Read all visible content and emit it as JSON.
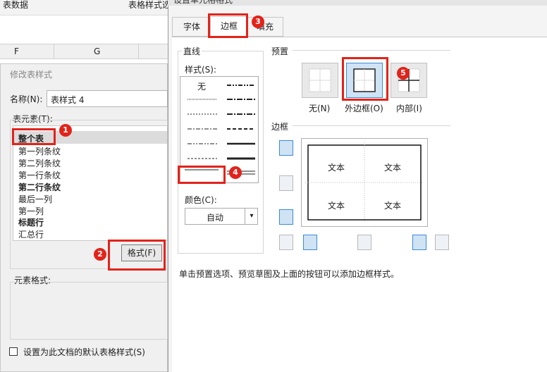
{
  "excel": {
    "toolbar": {
      "item_left": "表数据",
      "item_right": "表格样式选"
    },
    "columns": [
      "F",
      "G"
    ]
  },
  "modify_dialog": {
    "title": "修改表样式",
    "name_label": "名称(N):",
    "name_value": "表样式 4",
    "elements_label": "表元素(T):",
    "elements": [
      {
        "label": "整个表",
        "bold": true,
        "selected": true
      },
      {
        "label": "第一列条纹",
        "bold": false
      },
      {
        "label": "第二列条纹",
        "bold": false
      },
      {
        "label": "第一行条纹",
        "bold": false
      },
      {
        "label": "第二行条纹",
        "bold": true
      },
      {
        "label": "最后一列",
        "bold": false
      },
      {
        "label": "第一列",
        "bold": false
      },
      {
        "label": "标题行",
        "bold": true
      },
      {
        "label": "汇总行",
        "bold": false
      }
    ],
    "format_button": "格式(F)",
    "element_format_label": "元素格式:",
    "default_checkbox_label": "设置为此文档的默认表格样式(S)"
  },
  "format_dialog": {
    "title": "设置单元格格式",
    "tabs": [
      "字体",
      "边框",
      "填充"
    ],
    "active_tab": "边框",
    "line_group": "直线",
    "style_label": "样式(S):",
    "style_none": "无",
    "color_label": "颜色(C):",
    "color_value": "自动",
    "presets_label": "预置",
    "presets": [
      {
        "label": "无(N)"
      },
      {
        "label": "外边框(O)",
        "selected": true
      },
      {
        "label": "内部(I)"
      }
    ],
    "border_label": "边框",
    "preview_cells": [
      "文本",
      "文本",
      "文本",
      "文本"
    ],
    "hint": "单击预置选项、预览草图及上面的按钮可以添加边框样式。"
  },
  "annotations": [
    "1",
    "2",
    "3",
    "4",
    "5"
  ],
  "colors": {
    "annotation_red": "#e2231a",
    "selection_blue": "#3b8ad9"
  }
}
